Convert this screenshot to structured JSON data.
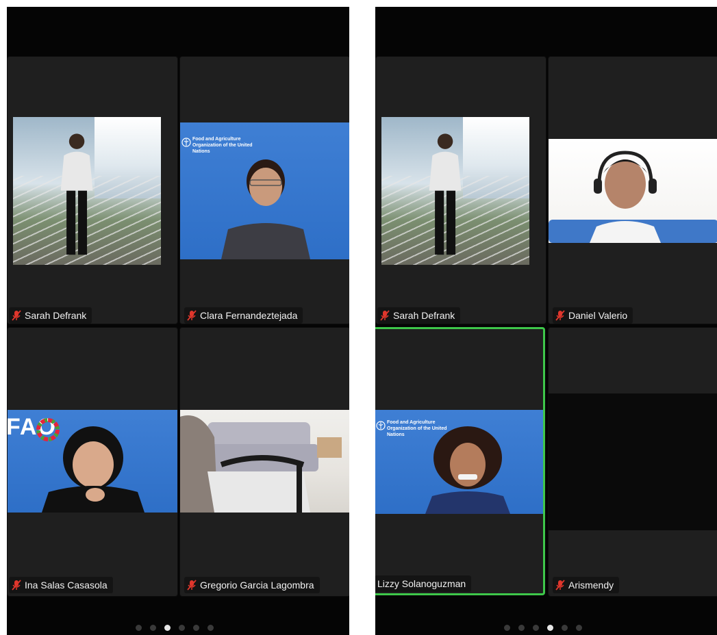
{
  "screens": [
    {
      "pager": {
        "count": 6,
        "active": 2
      },
      "tiles": [
        {
          "name": "Sarah Defrank",
          "muted": true,
          "active": false,
          "video": "scenic"
        },
        {
          "name": "Clara Fernandeztejada",
          "muted": true,
          "active": false,
          "video": "fao-blue"
        },
        {
          "name": "Ina Salas Casasola",
          "muted": true,
          "active": false,
          "video": "fao-blue"
        },
        {
          "name": "Gregorio Garcia Lagombra",
          "muted": true,
          "active": false,
          "video": "room"
        }
      ]
    },
    {
      "pager": {
        "count": 6,
        "active": 3
      },
      "tiles": [
        {
          "name": "Sarah Defrank",
          "muted": true,
          "active": false,
          "video": "scenic"
        },
        {
          "name": "Daniel Valerio",
          "muted": true,
          "active": false,
          "video": "home-office"
        },
        {
          "name": "Lizzy Solanoguzman",
          "muted": false,
          "active": true,
          "video": "fao-blue"
        },
        {
          "name": "Arismendy",
          "muted": true,
          "active": false,
          "video": "off"
        }
      ]
    }
  ],
  "logos": {
    "fao_org": "Food and Agriculture Organization of the United Nations",
    "fao_short": "FAO"
  },
  "colors": {
    "active_speaker_border": "#3ec74a",
    "muted_mic": "#e0362c",
    "video_blue": "#3f7fd4"
  }
}
